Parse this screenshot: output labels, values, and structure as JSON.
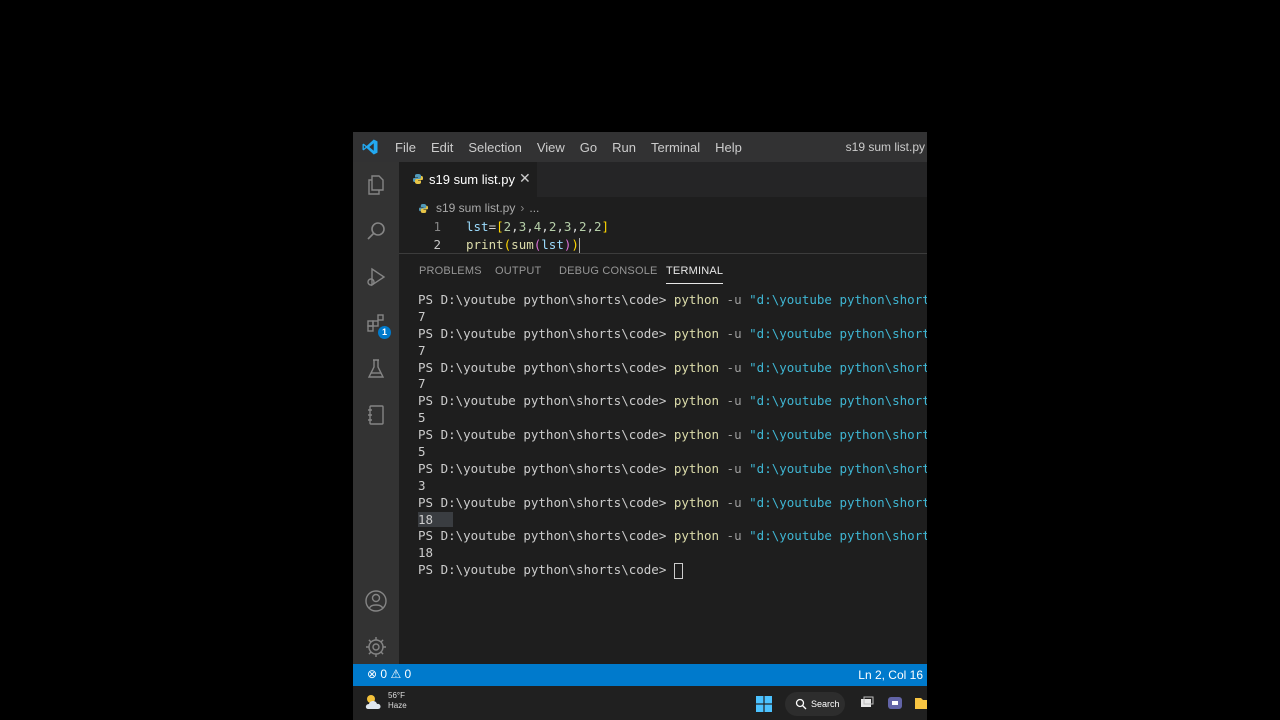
{
  "window_title": "s19 sum list.py",
  "menu": [
    "File",
    "Edit",
    "Selection",
    "View",
    "Go",
    "Run",
    "Terminal",
    "Help"
  ],
  "editor": {
    "tab_label": "s19 sum list.py",
    "breadcrumb_file": "s19 sum list.py",
    "breadcrumb_more": "...",
    "lines": [
      {
        "number": "1",
        "text": "lst=[2,3,4,2,3,2,2]"
      },
      {
        "number": "2",
        "text": "print(sum(lst))"
      }
    ]
  },
  "activity_bar": {
    "icons": [
      "explorer-icon",
      "search-icon",
      "run-debug-icon",
      "extensions-icon",
      "testing-icon",
      "notebook-icon",
      "account-icon",
      "settings-gear-icon"
    ],
    "extensions_badge": "1"
  },
  "panel": {
    "tabs": [
      "PROBLEMS",
      "OUTPUT",
      "DEBUG CONSOLE",
      "TERMINAL"
    ],
    "active_tab": "TERMINAL"
  },
  "terminal": {
    "prompt": "PS D:\\youtube python\\shorts\\code> ",
    "command": "python",
    "flag": " -u ",
    "argument": "\"d:\\youtube python\\shorts\\co",
    "outputs": [
      "7",
      "7",
      "7",
      "5",
      "5",
      "3",
      "18",
      "18"
    ]
  },
  "status_bar": {
    "errors": "0",
    "warnings": "0",
    "cursor_position": "Ln 2, Col 16"
  },
  "taskbar": {
    "temperature": "56°F",
    "condition": "Haze",
    "search_label": "Search"
  },
  "colors": {
    "status_bar": "#007acc",
    "terminal_command": "#dcdcaa",
    "terminal_string": "#3fb6d3"
  }
}
